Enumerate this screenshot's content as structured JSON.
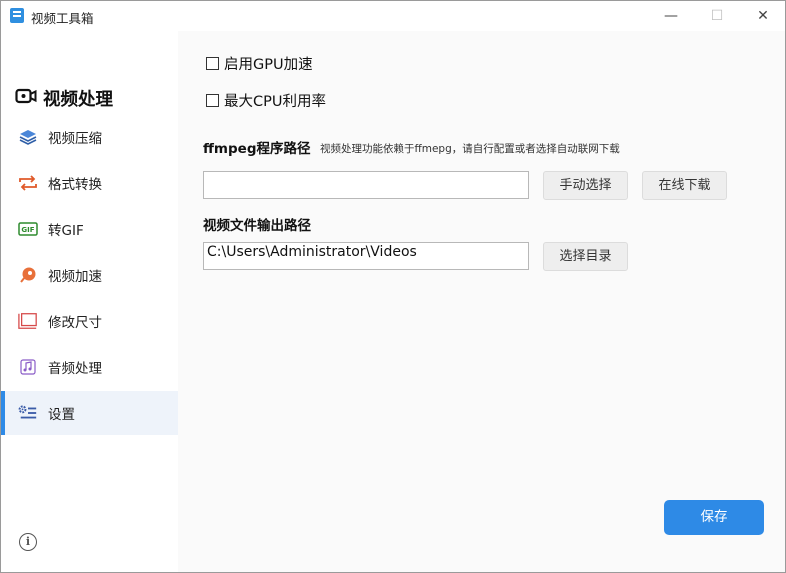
{
  "window": {
    "title": "视频工具箱",
    "controls": {
      "minimize": "—",
      "maximize": "☐",
      "close": "✕"
    }
  },
  "sidebar": {
    "header": "视频处理",
    "items": [
      {
        "label": "视频压缩",
        "icon": "layers-icon",
        "active": false
      },
      {
        "label": "格式转换",
        "icon": "convert-icon",
        "active": false
      },
      {
        "label": "转GIF",
        "icon": "gif-icon",
        "active": false
      },
      {
        "label": "视频加速",
        "icon": "rocket-icon",
        "active": false
      },
      {
        "label": "修改尺寸",
        "icon": "resize-icon",
        "active": false
      },
      {
        "label": "音频处理",
        "icon": "music-icon",
        "active": false
      },
      {
        "label": "设置",
        "icon": "settings-icon",
        "active": true
      }
    ],
    "info_icon": "i"
  },
  "settings": {
    "gpu_label": "启用GPU加速",
    "gpu_checked": false,
    "cpu_label": "最大CPU利用率",
    "cpu_checked": false,
    "ffmpeg_title": "ffmpeg程序路径",
    "ffmpeg_hint": "视频处理功能依赖于ffmepg，请自行配置或者选择自动联网下载",
    "ffmpeg_path_value": "",
    "manual_select_label": "手动选择",
    "online_download_label": "在线下载",
    "output_title": "视频文件输出路径",
    "output_path_value": "C:\\Users\\Administrator\\Videos",
    "choose_dir_label": "选择目录",
    "save_label": "保存"
  },
  "colors": {
    "accent": "#2e8ae6",
    "active_bg": "#eef3fa"
  }
}
